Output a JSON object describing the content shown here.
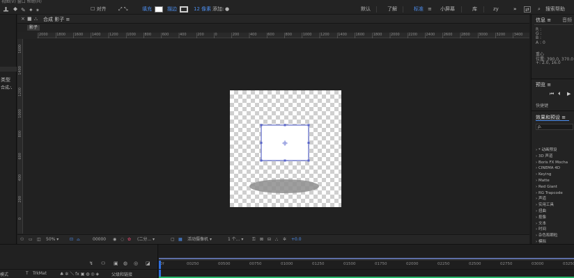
{
  "menubar": {
    "text": "视图(V)  窗口  帮助(H)"
  },
  "toolbar": {
    "align_label": "对齐",
    "fill_label": "填充",
    "stroke_label": "描边",
    "stroke_width": "12 像素",
    "add_label": "添加:",
    "workspaces": [
      "默认",
      "了解",
      "标准",
      "小屏幕",
      "库",
      "zy"
    ],
    "active_workspace_index": 2,
    "search_placeholder": "搜索帮助",
    "colors": {
      "accent": "#4d8ff0",
      "fill": "#ffffff"
    }
  },
  "left_panel": {
    "type_label": "类型",
    "comp_label": "合成"
  },
  "composition": {
    "tab_title": "合成 影子",
    "sub_label": "影子",
    "ruler_top": [
      "2000",
      "1800",
      "1600",
      "1400",
      "1200",
      "1000",
      "800",
      "600",
      "400",
      "200",
      "0",
      "200",
      "400",
      "600",
      "800",
      "1000",
      "1200",
      "1400",
      "1600",
      "1800",
      "2000",
      "2200",
      "2400",
      "2600",
      "2800",
      "3000",
      "3200",
      "3400"
    ],
    "ruler_left": [
      "1600",
      "1400",
      "1200",
      "1000",
      "800",
      "600",
      "400",
      "200",
      "0"
    ],
    "footer": {
      "zoom": "50%",
      "timecode": "00000",
      "resolution": "(二分...",
      "camera": "活动摄像机",
      "views": "1 个...",
      "exposure": "+0.0"
    }
  },
  "info_panel": {
    "title": "信息",
    "tab2": "音频",
    "r": "R :",
    "g": "G :",
    "b": "B :",
    "a": "A : 0",
    "layer_name": "重心",
    "position": "位置: 390.0, 370.0",
    "size": "+: 2.0, 16.0"
  },
  "preview_panel": {
    "title": "预览",
    "shortcut": "快捷键"
  },
  "effects_panel": {
    "title": "效果和预设",
    "search_placeholder": "ρ.",
    "items": [
      "* 动画预设",
      "3D 声道",
      "Boris FX Mocha",
      "CINEMA 4D",
      "Keying",
      "Matte",
      "Red Giant",
      "RG Trapcode",
      "声道",
      "实用工具",
      "扭曲",
      "抠像",
      "文本",
      "时间",
      "杂色和颗粒",
      "模拟",
      "模糊和锐化"
    ]
  },
  "timeline": {
    "mode_label": "模式",
    "t_label": "T",
    "trkmat_label": "TrkMat",
    "parent_label": "父级和链接",
    "ticks": [
      "0f",
      "00250",
      "00500",
      "00750",
      "01000",
      "01250",
      "01500",
      "01750",
      "02000",
      "02250",
      "02500",
      "02750",
      "03000",
      "03250"
    ]
  }
}
